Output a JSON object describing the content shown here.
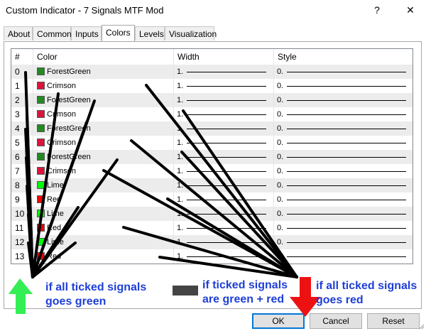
{
  "window": {
    "title": "Custom Indicator - 7 Signals MTF Mod",
    "help_label": "?",
    "close_label": "✕"
  },
  "tabs": [
    {
      "label": "About"
    },
    {
      "label": "Common"
    },
    {
      "label": "Inputs"
    },
    {
      "label": "Colors",
      "active": true
    },
    {
      "label": "Levels"
    },
    {
      "label": "Visualization"
    }
  ],
  "table": {
    "headers": {
      "index": "#",
      "color": "Color",
      "width": "Width",
      "style": "Style"
    },
    "rows": [
      {
        "index": "0",
        "color": "ForestGreen",
        "hex": "#228b22",
        "width": "1.",
        "style": "0."
      },
      {
        "index": "1",
        "color": "Crimson",
        "hex": "#dc143c",
        "width": "1.",
        "style": "0."
      },
      {
        "index": "2",
        "color": "ForestGreen",
        "hex": "#228b22",
        "width": "1.",
        "style": "0."
      },
      {
        "index": "3",
        "color": "Crimson",
        "hex": "#dc143c",
        "width": "1.",
        "style": "0."
      },
      {
        "index": "4",
        "color": "ForestGreen",
        "hex": "#228b22",
        "width": "1.",
        "style": "0."
      },
      {
        "index": "5",
        "color": "Crimson",
        "hex": "#dc143c",
        "width": "1.",
        "style": "0."
      },
      {
        "index": "6",
        "color": "ForestGreen",
        "hex": "#228b22",
        "width": "1.",
        "style": "0."
      },
      {
        "index": "7",
        "color": "Crimson",
        "hex": "#dc143c",
        "width": "1.",
        "style": "0."
      },
      {
        "index": "8",
        "color": "Lime",
        "hex": "#00ff00",
        "width": "1.",
        "style": "0."
      },
      {
        "index": "9",
        "color": "Red",
        "hex": "#ff0000",
        "width": "1.",
        "style": "0."
      },
      {
        "index": "10",
        "color": "Lime",
        "hex": "#00ff00",
        "width": "1.",
        "style": "0."
      },
      {
        "index": "11",
        "color": "Red",
        "hex": "#ff0000",
        "width": "1.",
        "style": "0."
      },
      {
        "index": "12",
        "color": "Lime",
        "hex": "#00ff00",
        "width": "1.",
        "style": "0."
      },
      {
        "index": "13",
        "color": "Red",
        "hex": "#ff0000",
        "width": "1.",
        "style": "0."
      }
    ]
  },
  "annotations": {
    "green_note": [
      "if all ticked signals",
      "goes green"
    ],
    "mixed_note": [
      "if ticked signals",
      "are green + red"
    ],
    "red_note": [
      "if all ticked signals",
      "goes red"
    ],
    "green_arrow_color": "#33ee55",
    "red_arrow_color": "#ee1111",
    "mixed_marker_color": "#444444",
    "text_color": "#1f3fd6"
  },
  "buttons": {
    "ok": "OK",
    "cancel": "Cancel",
    "reset": "Reset"
  }
}
